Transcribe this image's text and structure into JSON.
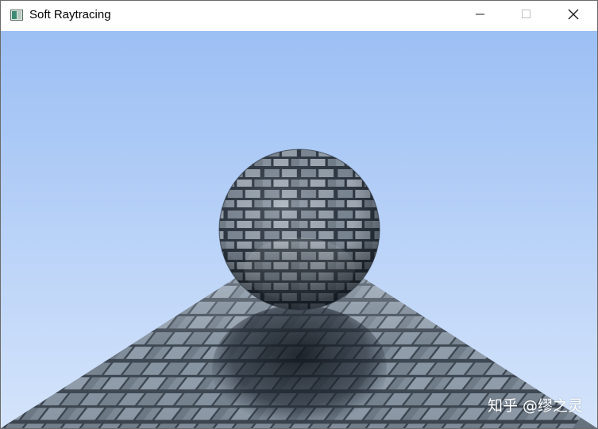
{
  "window": {
    "title": "Soft Raytracing",
    "app_icon": "window-app-icon",
    "controls": {
      "minimize_icon": "minimize-icon",
      "maximize_icon": "maximize-icon",
      "close_icon": "close-icon"
    }
  },
  "scene": {
    "description_objects": [
      "sky",
      "stone-brick-floor",
      "stone-brick-sphere",
      "sphere-shadow"
    ],
    "colors": {
      "sky_top": "#9cbff4",
      "sky_bottom": "#cfe1fb",
      "brick": "#7d8a99",
      "mortar": "#3d4752"
    }
  },
  "watermark": {
    "text": "知乎 @缪之灵"
  }
}
